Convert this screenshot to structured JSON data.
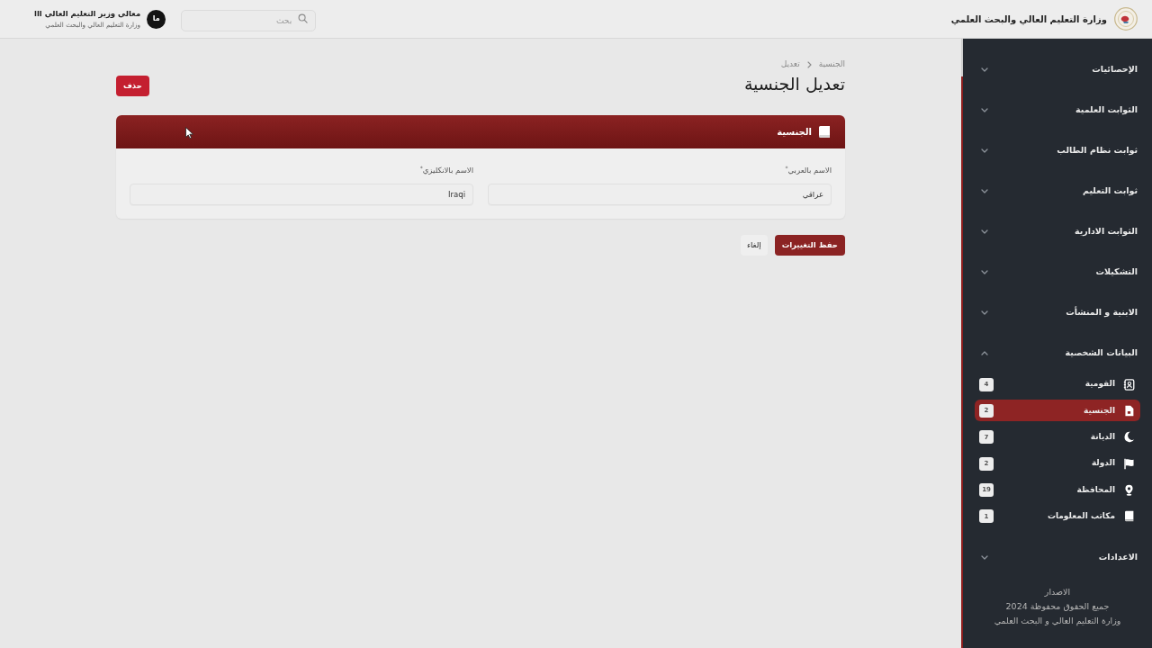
{
  "header": {
    "title": "وزارة التعليم العالي والبحث العلمي",
    "search": {
      "placeholder": "بحث"
    },
    "user": {
      "avatar": "ما",
      "name": "معالي وزير التعليم العالي ااا",
      "subtitle": "وزارة التعليم العالي والبحث العلمي"
    }
  },
  "sidebar": {
    "groups": [
      {
        "label": "الإحصائيات",
        "expanded": false
      },
      {
        "label": "الثوابت العلمية",
        "expanded": false
      },
      {
        "label": "ثوابت نظام الطالب",
        "expanded": false
      },
      {
        "label": "ثوابت التعليم",
        "expanded": false
      },
      {
        "label": "الثوابت الادارية",
        "expanded": false
      },
      {
        "label": "التشكيلات",
        "expanded": false
      },
      {
        "label": "الابنية و المنشأت",
        "expanded": false
      },
      {
        "label": "البيانات الشخصية",
        "expanded": true,
        "children": [
          {
            "label": "القومية",
            "count": "4",
            "selected": false
          },
          {
            "label": "الجنسية",
            "count": "2",
            "selected": true
          },
          {
            "label": "الديانة",
            "count": "7",
            "selected": false
          },
          {
            "label": "الدولة",
            "count": "2",
            "selected": false
          },
          {
            "label": "المحافظة",
            "count": "19",
            "selected": false
          },
          {
            "label": "مكاتب المعلومات",
            "count": "1",
            "selected": false
          }
        ]
      },
      {
        "label": "الاعدادات",
        "expanded": false
      }
    ],
    "footer": [
      "الاصدار",
      "جميع الحقوق محفوظة 2024",
      "وزارة التعليم العالي و البحث العلمي"
    ]
  },
  "breadcrumb": [
    "الجنسية",
    "تعديل"
  ],
  "page_title": "تعديل الجنسية",
  "delete_button": "حذف",
  "card": {
    "title": "الجنسية",
    "fields": [
      {
        "label": "الاسم بالعربي$^{*}$",
        "value": "عراقي"
      },
      {
        "label": "الاسم بالانكليزي$^{*}$",
        "value": "Iraqi"
      }
    ]
  },
  "actions": [
    {
      "label": "حفظ التغييرات",
      "kind": "save"
    },
    {
      "label": "إلغاء",
      "kind": "cancel"
    }
  ]
}
